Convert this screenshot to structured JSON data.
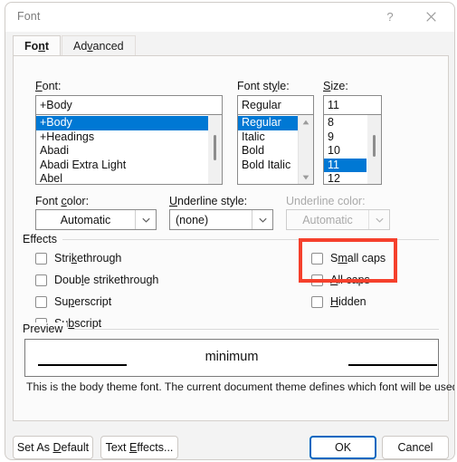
{
  "window": {
    "title": "Font",
    "help_icon": "question-mark-icon",
    "close_icon": "close-icon"
  },
  "tabs": [
    {
      "label": "Font",
      "accel": "n",
      "active": true
    },
    {
      "label": "Advanced",
      "accel": "v",
      "active": false
    }
  ],
  "font_section": {
    "font_label": "Font:",
    "font_label_accel": "F",
    "font_value": "+Body",
    "font_options": [
      "+Body",
      "+Headings",
      "Abadi",
      "Abadi Extra Light",
      "Abel"
    ],
    "font_selected": "+Body",
    "style_label": "Font style:",
    "style_label_accel": "y",
    "style_value": "Regular",
    "style_options": [
      "Regular",
      "Italic",
      "Bold",
      "Bold Italic"
    ],
    "style_selected": "Regular",
    "size_label": "Size:",
    "size_label_accel": "S",
    "size_value": "11",
    "size_options": [
      "8",
      "9",
      "10",
      "11",
      "12"
    ],
    "size_selected": "11"
  },
  "color_row": {
    "font_color_label": "Font color:",
    "font_color_accel": "c",
    "font_color_value": "Automatic",
    "underline_style_label": "Underline style:",
    "underline_style_accel": "U",
    "underline_style_value": "(none)",
    "underline_color_label": "Underline color:",
    "underline_color_value": "Automatic",
    "underline_color_disabled": true
  },
  "effects": {
    "group_title": "Effects",
    "left_items": [
      {
        "label": "Strikethrough",
        "accel": "k",
        "checked": false
      },
      {
        "label": "Double strikethrough",
        "accel": "l",
        "checked": false
      },
      {
        "label": "Superscript",
        "accel": "p",
        "checked": false
      },
      {
        "label": "Subscript",
        "accel": "b",
        "checked": false
      }
    ],
    "right_items": [
      {
        "label": "Small caps",
        "accel": "m",
        "checked": false
      },
      {
        "label": "All caps",
        "accel": "A",
        "checked": false
      },
      {
        "label": "Hidden",
        "accel": "H",
        "checked": false
      }
    ]
  },
  "preview": {
    "group_title": "Preview",
    "sample_text": "minimum",
    "note": "This is the body theme font. The current document theme defines which font will be used."
  },
  "footer": {
    "set_as_default": "Set As Default",
    "set_as_default_accel": "D",
    "text_effects": "Text Effects...",
    "text_effects_accel": "E",
    "ok": "OK",
    "cancel": "Cancel"
  },
  "annotation": {
    "color": "#f5402c",
    "target": "small-caps-and-all-caps"
  }
}
